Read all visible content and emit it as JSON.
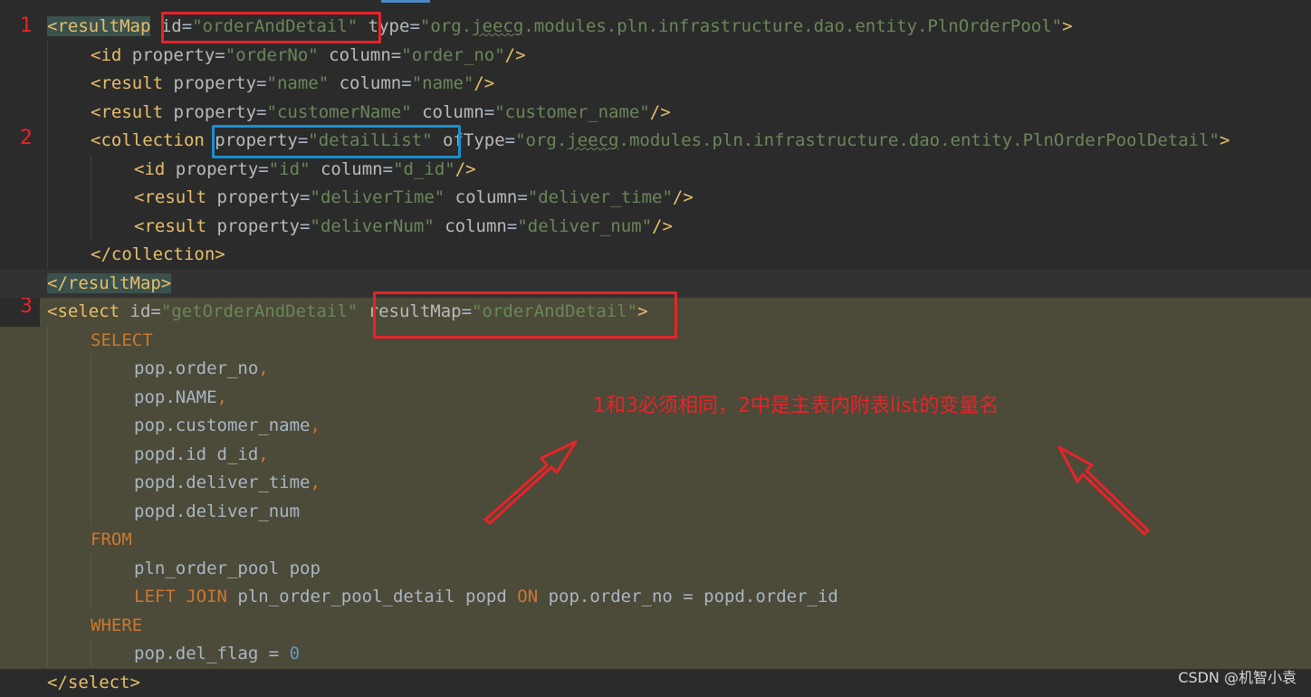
{
  "gutter_labels": [
    "1",
    "2",
    "3"
  ],
  "code_lines": {
    "l1": {
      "tag": "<resultMap",
      "attr1": "id",
      "val1": "\"orderAndDetail\"",
      "attr2": "type",
      "val2a": "\"org.",
      "val2b": "jeecg",
      "val2c": ".modules.pln.infrastructure.dao.entity.PlnOrderPool\"",
      "end": ">"
    },
    "l2": {
      "tag": "<id",
      "attr1": "property",
      "val1": "\"orderNo\"",
      "attr2": "column",
      "val2": "\"order_no\"",
      "end": "/>"
    },
    "l3": {
      "tag": "<result",
      "attr1": "property",
      "val1": "\"name\"",
      "attr2": "column",
      "val2": "\"name\"",
      "end": "/>"
    },
    "l4": {
      "tag": "<result",
      "attr1": "property",
      "val1": "\"customerName\"",
      "attr2": "column",
      "val2": "\"customer_name\"",
      "end": "/>"
    },
    "l5": {
      "tag": "<collection",
      "attr1": "property",
      "val1": "\"detailList\"",
      "attr2": "ofType",
      "val2a": "\"org.",
      "val2b": "jeecg",
      "val2c": ".modules.pln.infrastructure.dao.entity.PlnOrderPoolDetail\"",
      "end": ">"
    },
    "l6": {
      "tag": "<id",
      "attr1": "property",
      "val1": "\"id\"",
      "attr2": "column",
      "val2": "\"d_id\"",
      "end": "/>"
    },
    "l7": {
      "tag": "<result",
      "attr1": "property",
      "val1": "\"deliverTime\"",
      "attr2": "column",
      "val2": "\"deliver_time\"",
      "end": "/>"
    },
    "l8": {
      "tag": "<result",
      "attr1": "property",
      "val1": "\"deliverNum\"",
      "attr2": "column",
      "val2": "\"deliver_num\"",
      "end": "/>"
    },
    "l9": {
      "tag": "</collection>"
    },
    "l10": {
      "tag": "</resultMap>"
    },
    "l11": {
      "tag": "<select",
      "attr1": "id",
      "val1": "\"getOrderAndDetail\"",
      "attr2": "resultMap",
      "val2": "\"orderAndDetail\"",
      "end": ">"
    },
    "l12": {
      "kw": "SELECT"
    },
    "l13": {
      "text": "pop.order_no",
      "comma": ","
    },
    "l14": {
      "text": "pop.NAME",
      "comma": ","
    },
    "l15": {
      "text": "pop.customer_name",
      "comma": ","
    },
    "l16": {
      "text": "popd.id d_id",
      "comma": ","
    },
    "l17": {
      "text": "popd.deliver_time",
      "comma": ","
    },
    "l18": {
      "text": "popd.deliver_num"
    },
    "l19": {
      "kw": "FROM"
    },
    "l20": {
      "text": "pln_order_pool pop"
    },
    "l21": {
      "kw1": "LEFT JOIN",
      "text1": " pln_order_pool_detail popd ",
      "kw2": "ON",
      "text2": " pop.order_no = popd.order_id"
    },
    "l22": {
      "kw": "WHERE"
    },
    "l23": {
      "text": "pop.del_flag = ",
      "num": "0"
    },
    "l24": {
      "tag": "</select>"
    }
  },
  "annotation": "1和3必须相同，2中是主表内附表list的变量名",
  "watermark": "CSDN @机智小袁",
  "colors": {
    "tag": "#e8bf6a",
    "value": "#6a8759",
    "keyword": "#cc7832",
    "number": "#6897bb",
    "highlight_box": "#e8232a",
    "blue_box": "#1a8fd0"
  }
}
